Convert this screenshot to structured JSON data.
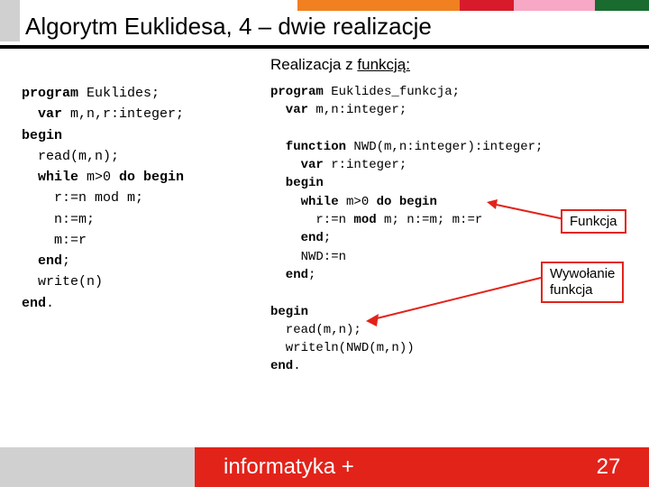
{
  "title": "Algorytm Euklidesa, 4 – dwie realizacje",
  "subheader_text": "Realizacja z",
  "subheader_underlined": "funkcją:",
  "left_code": {
    "l01a": "program",
    "l01b": " Euklides;",
    "l02a": "  var",
    "l02b": " m,n,r:integer;",
    "l03a": "begin",
    "l03b": "",
    "l04": "  read(m,n);",
    "l05a": "  while",
    "l05b": " m>0 ",
    "l05c": "do begin",
    "l06": "    r:=n mod m;",
    "l07": "    n:=m;",
    "l08": "    m:=r",
    "l09a": "  end",
    "l09b": ";",
    "l10": "  write(n)",
    "l11a": "end",
    "l11b": "."
  },
  "right_code": {
    "l01a": "program",
    "l01b": " Euklides_funkcja;",
    "l02a": "  var",
    "l02b": " m,n:integer;",
    "blank1": " ",
    "l03a": "  function",
    "l03b": " NWD(m,n:integer):integer;",
    "l04a": "    var",
    "l04b": " r:integer;",
    "l05a": "  begin",
    "l06a": "    while",
    "l06b": " m>0 ",
    "l06c": "do begin",
    "l07a": "      r:=n ",
    "l07b": "mod",
    "l07c": " m; n:=m; m:=r",
    "l08a": "    end",
    "l08b": ";",
    "l09": "    NWD:=n",
    "l10a": "  end",
    "l10b": ";",
    "blank2": " ",
    "l11a": "begin",
    "l12": "  read(m,n);",
    "l13": "  writeln(NWD(m,n))",
    "l14a": "end",
    "l14b": "."
  },
  "callouts": {
    "funkcja": "Funkcja",
    "wywolanie_l1": "Wywołanie",
    "wywolanie_l2": "funkcja"
  },
  "footer": {
    "brand": "informatyka +",
    "page": "27"
  }
}
